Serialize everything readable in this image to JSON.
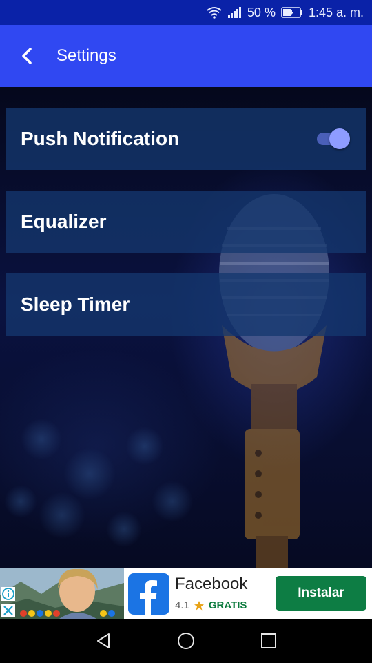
{
  "status_bar": {
    "battery_percent": "50 %",
    "time": "1:45 a. m.",
    "icons": [
      "wifi-icon",
      "signal-icon",
      "battery-icon"
    ]
  },
  "app_bar": {
    "title": "Settings",
    "back_icon": "back-arrow-icon"
  },
  "settings": {
    "items": [
      {
        "label": "Push Notification",
        "toggle": true,
        "toggle_on": true
      },
      {
        "label": "Equalizer"
      },
      {
        "label": "Sleep Timer"
      }
    ]
  },
  "ad": {
    "app_name": "Facebook",
    "rating": "4.1",
    "price_label": "GRATIS",
    "install_label": "Instalar",
    "icons": [
      "ad-info-icon",
      "ad-close-icon",
      "facebook-logo",
      "star-icon"
    ]
  },
  "nav_bar": {
    "icons": [
      "back-triangle-icon",
      "home-circle-icon",
      "recents-square-icon"
    ]
  },
  "colors": {
    "status_bar": "#0a22a8",
    "app_bar": "#3048f2",
    "row_bg": "#14376e",
    "toggle_thumb": "#8e9cff",
    "install_button": "#0d7d44",
    "facebook_blue": "#1b74e4"
  }
}
